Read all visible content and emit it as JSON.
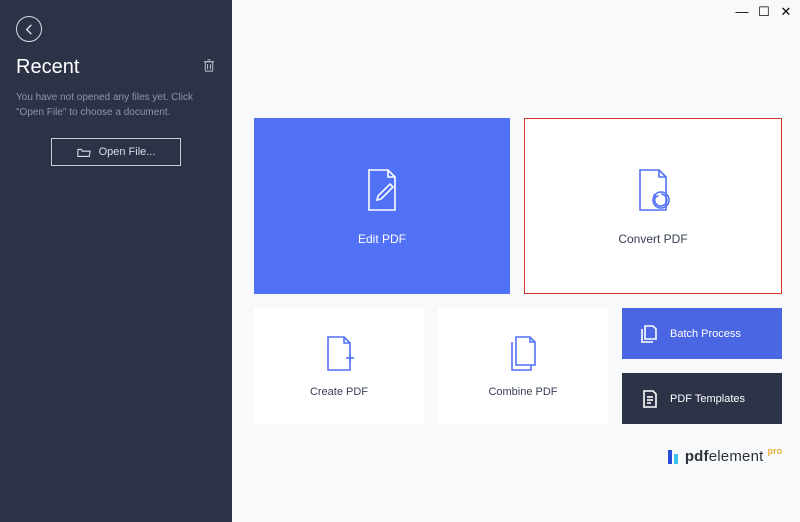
{
  "window": {
    "min": "—",
    "max": "☐",
    "close": "✕"
  },
  "sidebar": {
    "title": "Recent",
    "hint": "You have not opened any files yet. Click \"Open File\" to choose a document.",
    "open_label": "Open File..."
  },
  "cards": {
    "edit": "Edit PDF",
    "convert": "Convert PDF",
    "create": "Create PDF",
    "combine": "Combine PDF",
    "batch": "Batch Process",
    "templates": "PDF Templates"
  },
  "branding": {
    "name_bold": "pdf",
    "name_thin": "element",
    "suffix": "pro"
  }
}
